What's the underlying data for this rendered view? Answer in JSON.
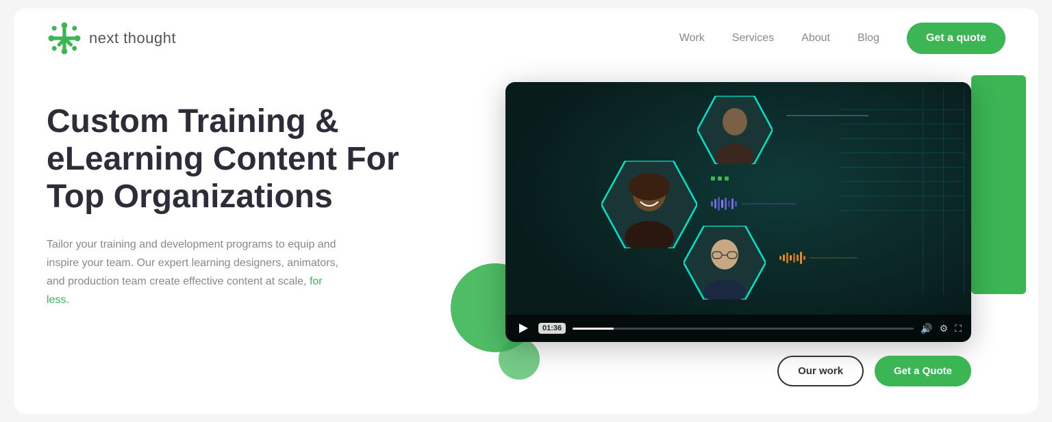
{
  "logo": {
    "text": "next thought"
  },
  "nav": {
    "items": [
      {
        "label": "Work",
        "href": "#work"
      },
      {
        "label": "Services",
        "href": "#services"
      },
      {
        "label": "About",
        "href": "#about"
      },
      {
        "label": "Blog",
        "href": "#blog"
      }
    ],
    "cta_label": "Get a quote"
  },
  "hero": {
    "title": "Custom Training & eLearning Content For Top Organizations",
    "subtitle": "Tailor your training and development programs to equip and inspire your team. Our expert learning designers, animators, and production team create effective content at scale, for less.",
    "subtitle_highlight": "for less."
  },
  "video": {
    "timestamp": "01:36",
    "progress_percent": 12
  },
  "bottom_cta": {
    "our_work_label": "Our work",
    "get_quote_label": "Get a Quote"
  }
}
